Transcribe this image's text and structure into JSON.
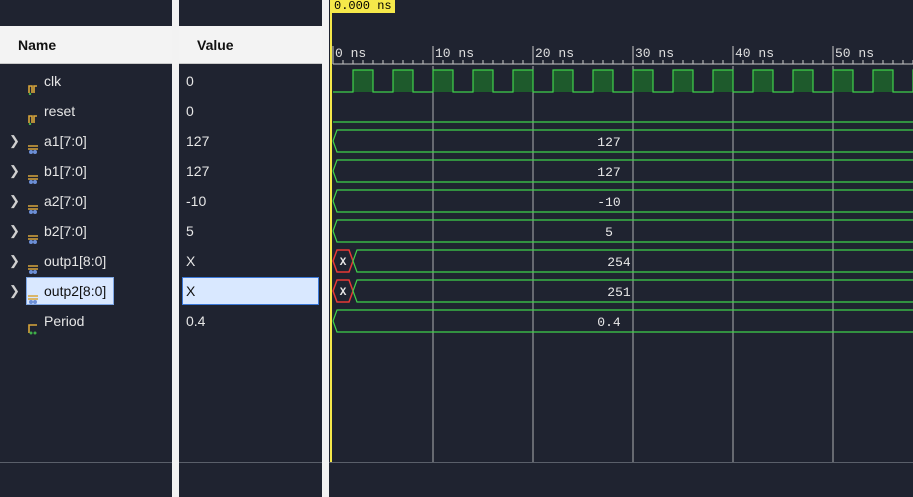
{
  "columns": {
    "name": "Name",
    "value": "Value"
  },
  "cursor_time": "0.000 ns",
  "time_ticks": [
    "0 ns",
    "10 ns",
    "20 ns",
    "30 ns",
    "40 ns",
    "50 ns"
  ],
  "signals": [
    {
      "name": "clk",
      "value": "0",
      "type": "bit",
      "expandable": false,
      "icon": "bit-signal-icon"
    },
    {
      "name": "reset",
      "value": "0",
      "type": "bit",
      "expandable": false,
      "icon": "bit-signal-icon"
    },
    {
      "name": "a1[7:0]",
      "value": "127",
      "type": "bus",
      "expandable": true,
      "icon": "bus-signal-icon",
      "wave_value": "127"
    },
    {
      "name": "b1[7:0]",
      "value": "127",
      "type": "bus",
      "expandable": true,
      "icon": "bus-signal-icon",
      "wave_value": "127"
    },
    {
      "name": "a2[7:0]",
      "value": "-10",
      "type": "bus",
      "expandable": true,
      "icon": "bus-signal-icon",
      "wave_value": "-10"
    },
    {
      "name": "b2[7:0]",
      "value": "5",
      "type": "bus",
      "expandable": true,
      "icon": "bus-signal-icon",
      "wave_value": "5"
    },
    {
      "name": "outp1[8:0]",
      "value": "X",
      "type": "bus",
      "expandable": true,
      "icon": "bus-signal-icon",
      "wave_x": "X",
      "wave_value": "254"
    },
    {
      "name": "outp2[8:0]",
      "value": "X",
      "type": "bus",
      "expandable": true,
      "icon": "bus-signal-icon",
      "selected": true,
      "wave_x": "X",
      "wave_value": "251"
    },
    {
      "name": "Period",
      "value": "0.4",
      "type": "real",
      "expandable": false,
      "icon": "real-signal-icon",
      "wave_value": "0.4"
    }
  ],
  "colors": {
    "wave": "#3fd14a",
    "clock_fill": "#1e5a2c",
    "x_state": "#e53935",
    "grid": "#c8c8c8",
    "cursor": "#f5e84a",
    "selection": "#d9e8ff"
  }
}
